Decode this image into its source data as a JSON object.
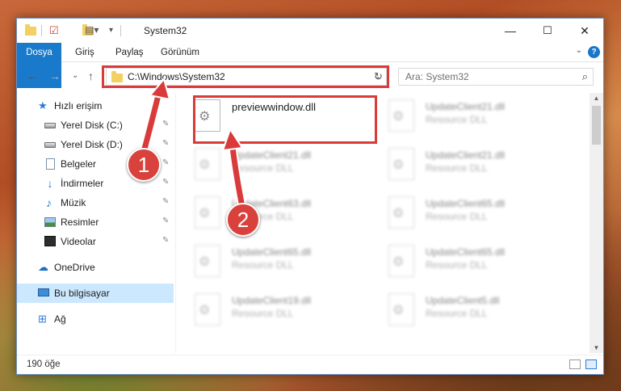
{
  "window": {
    "title": "System32"
  },
  "title_controls": {
    "minimize": "—",
    "maximize": "☐",
    "close": "✕"
  },
  "ribbon": {
    "tabs": [
      "Dosya",
      "Giriş",
      "Paylaş",
      "Görünüm"
    ],
    "help": "?",
    "expand": "⌄"
  },
  "address_bar": {
    "path": "C:\\Windows\\System32",
    "dropdown": "⌄",
    "refresh": "↻"
  },
  "search": {
    "placeholder": "Ara: System32",
    "icon": "search-icon"
  },
  "nav": {
    "back": "←",
    "forward": "→",
    "recent": "⌄",
    "up": "↑"
  },
  "sidebar": {
    "items": [
      {
        "label": "Hızlı erişim",
        "icon": "star-icon"
      },
      {
        "label": "Yerel Disk (C:)",
        "icon": "drive-icon",
        "pinned": true
      },
      {
        "label": "Yerel Disk (D:)",
        "icon": "drive-icon",
        "pinned": true
      },
      {
        "label": "Belgeler",
        "icon": "documents-icon",
        "pinned": true
      },
      {
        "label": "İndirmeler",
        "icon": "downloads-icon",
        "pinned": true
      },
      {
        "label": "Müzik",
        "icon": "music-icon",
        "pinned": true
      },
      {
        "label": "Resimler",
        "icon": "pictures-icon",
        "pinned": true
      },
      {
        "label": "Videolar",
        "icon": "videos-icon",
        "pinned": true
      },
      {
        "label": "OneDrive",
        "icon": "onedrive-icon"
      },
      {
        "label": "Bu bilgisayar",
        "icon": "computer-icon",
        "selected": true
      },
      {
        "label": "Ağ",
        "icon": "network-icon"
      }
    ],
    "pin_glyph": "📌"
  },
  "files": [
    {
      "name": "previewwindow.dll",
      "type": "",
      "highlighted": true
    },
    {
      "name": "UpdateClient21.dll",
      "type": "Resource DLL"
    },
    {
      "name": "UpdateClient21.dll",
      "type": "Resource DLL"
    },
    {
      "name": "UpdateClient21.dll",
      "type": "Resource DLL"
    },
    {
      "name": "UpdateClient63.dll",
      "type": "Resource DLL"
    },
    {
      "name": "UpdateClient65.dll",
      "type": "Resource DLL"
    },
    {
      "name": "UpdateClient65.dll",
      "type": "Resource DLL"
    },
    {
      "name": "UpdateClient65.dll",
      "type": "Resource DLL"
    },
    {
      "name": "UpdateClient19.dll",
      "type": "Resource DLL"
    },
    {
      "name": "UpdateClient5.dll",
      "type": "Resource DLL"
    }
  ],
  "status_bar": {
    "item_count": "190 öğe"
  },
  "annotations": {
    "step1": "1",
    "step2": "2",
    "color": "#d93a3a"
  }
}
